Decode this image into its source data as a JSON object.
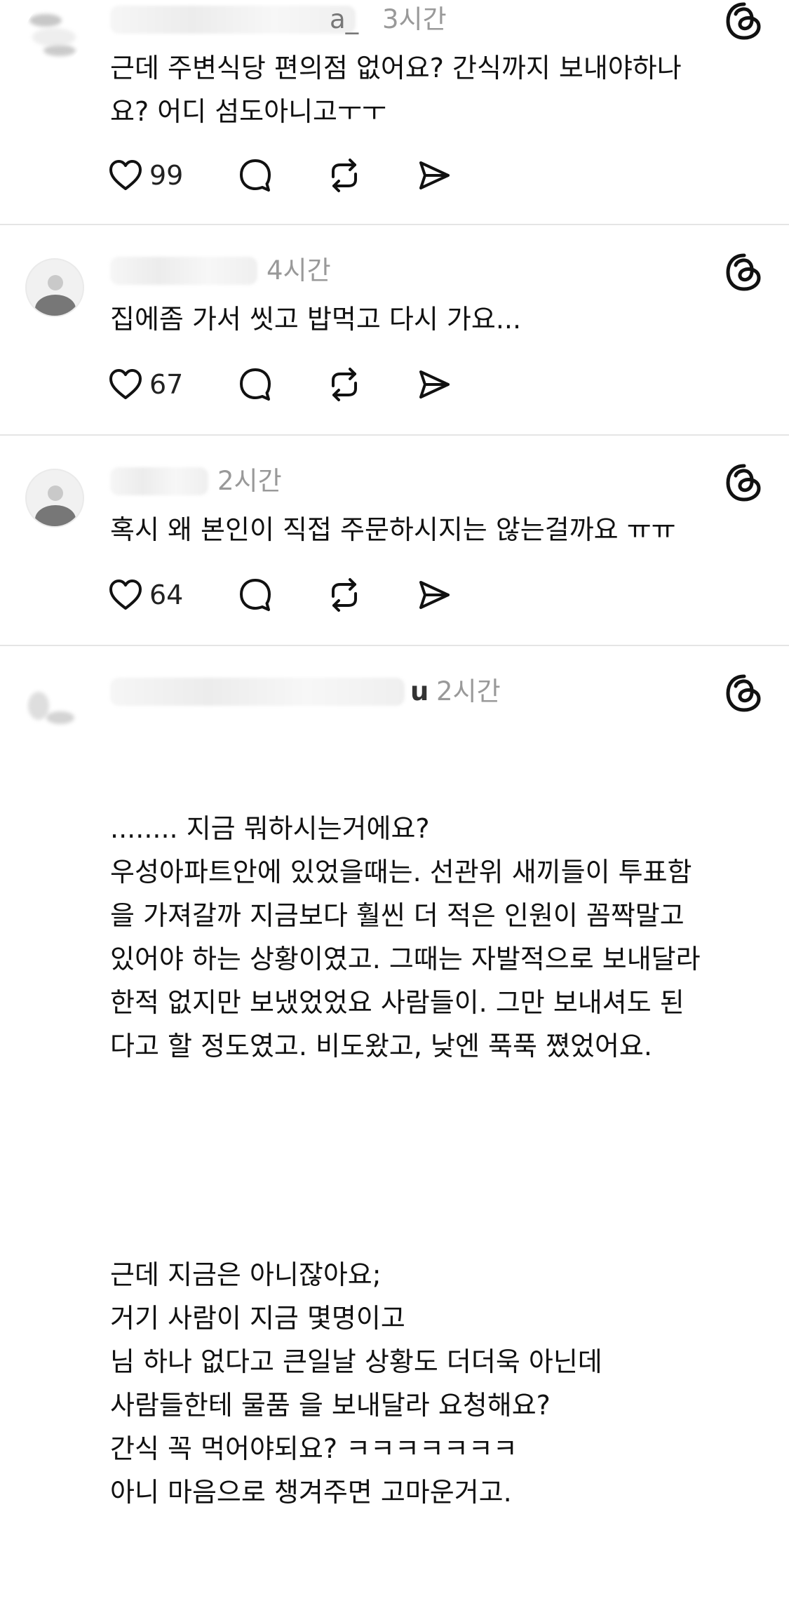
{
  "app": {
    "name": "Threads"
  },
  "icons": {
    "like": "heart-icon",
    "reply": "speech-bubble-icon",
    "repost": "repost-icon",
    "share": "send-icon",
    "brand": "threads-logo-icon"
  },
  "posts": [
    {
      "username_partial": "a_",
      "time": "3시간",
      "text": "근데 주변식당 편의점 없어요? 간식까지 보내야하나\n요? 어디 섬도아니고ㅜㅜ",
      "likes": "99"
    },
    {
      "username_partial": "",
      "time": "4시간",
      "text": "집에좀 가서 씻고 밥먹고 다시 가요...",
      "likes": "67"
    },
    {
      "username_partial": "",
      "time": "2시간",
      "text": "혹시 왜 본인이 직접 주문하시지는 않는걸까요 ㅠㅠ",
      "likes": "64"
    },
    {
      "username_partial": "u",
      "time": "2시간",
      "text_part1": "........ 지금 뭐하시는거에요?\n우성아파트안에 있었을때는. 선관위 새끼들이 투표함\n을 가져갈까 지금보다 훨씬 더 적은 인원이 꼼짝말고\n있어야 하는 상황이였고. 그때는 자발적으로 보내달라\n한적 없지만 보냈었었요 사람들이. 그만 보내셔도 된\n다고 할 정도였고. 비도왔고, 낮엔 푹푹 쪘었어요.",
      "text_part2": "근데 지금은 아니잖아요;\n거기 사람이 지금 몇명이고\n님 하나 없다고 큰일날 상황도 더더욱 아닌데\n사람들한테 물품 을 보내달라 요청해요?\n간식 꼭 먹어야되요? ㅋㅋㅋㅋㅋㅋㅋ\n아니 마음으로 챙겨주면 고마운거고."
    }
  ]
}
